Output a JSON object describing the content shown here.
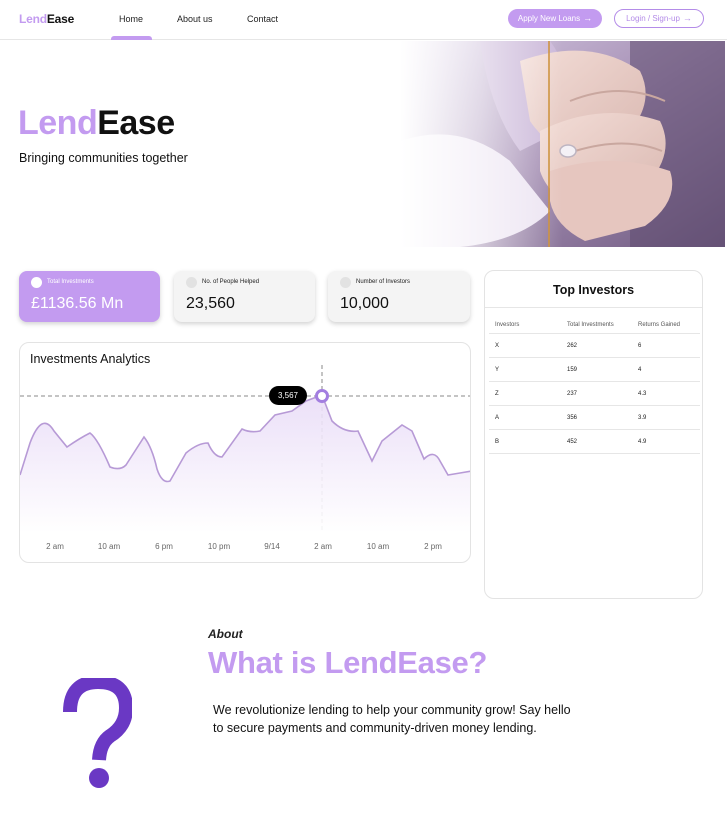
{
  "brand": {
    "lend": "Lend",
    "ease": "Ease"
  },
  "nav": {
    "home": "Home",
    "about": "About us",
    "contact": "Contact",
    "apply_label": "Apply New Loans",
    "login_label": "Login / Sign-up",
    "arrow_glyph": "→"
  },
  "hero": {
    "title_lend": "Lend",
    "title_ease": "Ease",
    "subtitle": "Bringing communities together"
  },
  "stats": [
    {
      "label": "Total Investments",
      "value": "£1136.56 Mn"
    },
    {
      "label": "No. of People Helped",
      "value": "23,560"
    },
    {
      "label": "Number of Investors",
      "value": "10,000"
    }
  ],
  "analytics": {
    "title": "Investments Analytics",
    "tooltip_value": "3,567",
    "x_labels": [
      "2 am",
      "10 am",
      "6 pm",
      "10 pm",
      "9/14",
      "2 am",
      "10 am",
      "2 pm"
    ]
  },
  "top_investors": {
    "title": "Top Investors",
    "headers": [
      "Investors",
      "Total Investments",
      "Returns Gained"
    ],
    "rows": [
      [
        "X",
        "262",
        "6"
      ],
      [
        "Y",
        "159",
        "4"
      ],
      [
        "Z",
        "237",
        "4.3"
      ],
      [
        "A",
        "356",
        "3.9"
      ],
      [
        "B",
        "452",
        "4.9"
      ]
    ]
  },
  "about": {
    "label": "About",
    "title": "What is LendEase?",
    "text": "We revolutionize lending to help your community grow! Say hello to secure payments and community-driven money lending."
  },
  "colors": {
    "accent": "#c39bf0",
    "accent_dark": "#6a38c4",
    "text": "#111111"
  }
}
